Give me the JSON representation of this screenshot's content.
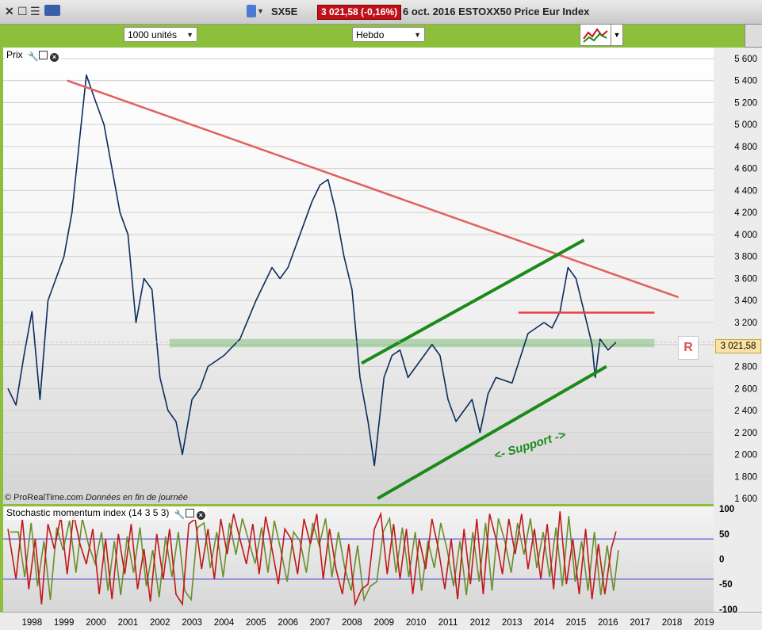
{
  "window": {
    "symbol": "SX5E",
    "price_badge": "3 021,58 (-0,16%)",
    "title": "6 oct. 2016 ESTOXX50 Price Eur Index"
  },
  "toolbar": {
    "units_select": "1000 unités",
    "period_select": "Hebdo"
  },
  "main_panel": {
    "label": "Prix",
    "credit_source": "© ProRealTime.com",
    "credit_note": "Données en fin de journée",
    "annotation_support": "<- Support ->",
    "resistance_tag": "R",
    "last_price_tag": "3 021,58"
  },
  "stoch_panel": {
    "label": "Stochastic momentum index (14 3 5 3)"
  },
  "colors": {
    "price_line": "#0b2d5b",
    "downtrend": "#e06060",
    "channel": "#1a8a1a",
    "support_zone": "#7ec27e",
    "resistance": "#e84040",
    "smi": "#c01818",
    "smi_signal": "#6a8e2a",
    "toolbar_bg": "#8cbf3a"
  },
  "chart_data": [
    {
      "type": "line",
      "x_ticks": [
        "1998",
        "1999",
        "2000",
        "2001",
        "2002",
        "2003",
        "2004",
        "2005",
        "2006",
        "2007",
        "2008",
        "2009",
        "2010",
        "2011",
        "2012",
        "2013",
        "2014",
        "2015",
        "2016",
        "2017",
        "2018",
        "2019"
      ],
      "y_ticks": [
        "1 600",
        "1 800",
        "2 000",
        "2 200",
        "2 400",
        "2 600",
        "2 800",
        "3 000",
        "3 200",
        "3 400",
        "3 600",
        "3 800",
        "4 000",
        "4 200",
        "4 400",
        "4 600",
        "4 800",
        "5 000",
        "5 200",
        "5 400",
        "5 600"
      ],
      "ylim": [
        1550,
        5700
      ],
      "xlim": [
        1997.6,
        2019.8
      ],
      "series": [
        {
          "x": [
            1997.75,
            1998.0,
            1998.25,
            1998.5,
            1998.75,
            1999.0,
            1999.25,
            1999.5,
            1999.75,
            2000.0,
            2000.2,
            2000.5,
            2000.75,
            2001.0,
            2001.25,
            2001.5,
            2001.75,
            2002.0,
            2002.25,
            2002.5,
            2002.75,
            2003.0,
            2003.2,
            2003.5,
            2003.75,
            2004.0,
            2004.5,
            2005.0,
            2005.5,
            2006.0,
            2006.25,
            2006.5,
            2007.0,
            2007.25,
            2007.5,
            2007.75,
            2008.0,
            2008.25,
            2008.5,
            2008.75,
            2009.0,
            2009.2,
            2009.5,
            2009.75,
            2010.0,
            2010.25,
            2010.5,
            2010.75,
            2011.0,
            2011.25,
            2011.5,
            2011.75,
            2012.0,
            2012.25,
            2012.5,
            2012.75,
            2013.0,
            2013.5,
            2014.0,
            2014.5,
            2014.75,
            2015.0,
            2015.25,
            2015.5,
            2015.75,
            2016.0,
            2016.1,
            2016.25,
            2016.5,
            2016.75
          ],
          "y": [
            2600,
            2450,
            2900,
            3300,
            2500,
            3400,
            3600,
            3800,
            4200,
            4900,
            5450,
            5200,
            5000,
            4600,
            4200,
            4000,
            3200,
            3600,
            3500,
            2700,
            2400,
            2300,
            2000,
            2500,
            2600,
            2800,
            2900,
            3050,
            3400,
            3700,
            3600,
            3700,
            4100,
            4300,
            4450,
            4500,
            4200,
            3800,
            3500,
            2700,
            2300,
            1900,
            2700,
            2900,
            2950,
            2700,
            2800,
            2900,
            3000,
            2900,
            2500,
            2300,
            2400,
            2500,
            2200,
            2550,
            2700,
            2650,
            3100,
            3200,
            3150,
            3300,
            3700,
            3600,
            3300,
            3000,
            2700,
            3050,
            2950,
            3020
          ]
        }
      ],
      "overlays": {
        "downtrend_line": {
          "x": [
            1999.6,
            2018.7
          ],
          "y": [
            5400,
            3430
          ]
        },
        "channel_upper": {
          "x": [
            2008.8,
            2015.75
          ],
          "y": [
            2830,
            3950
          ]
        },
        "channel_lower": {
          "x": [
            2009.3,
            2016.45
          ],
          "y": [
            1600,
            2800
          ]
        },
        "resistance_line": {
          "x": [
            2013.7,
            2017.95
          ],
          "y": [
            3290,
            3290
          ]
        },
        "support_zone": {
          "x": [
            2002.8,
            2017.95
          ],
          "y": [
            2975,
            3050
          ]
        },
        "last_price": 3021.58
      }
    },
    {
      "type": "line",
      "name": "Stochastic momentum index (14 3 5 3)",
      "y_ticks": [
        "100",
        "50",
        "0",
        "-50",
        "-100"
      ],
      "ylim": [
        -105,
        105
      ],
      "levels": [
        40,
        -40
      ],
      "series": [
        {
          "x": [
            1997.75,
            1998.0,
            1998.2,
            1998.4,
            1998.6,
            1998.8,
            1999.0,
            1999.2,
            1999.4,
            1999.6,
            1999.8,
            2000.0,
            2000.2,
            2000.4,
            2000.6,
            2000.8,
            2001.0,
            2001.2,
            2001.4,
            2001.6,
            2001.8,
            2002.0,
            2002.2,
            2002.4,
            2002.6,
            2002.8,
            2003.0,
            2003.2,
            2003.4,
            2003.6,
            2003.8,
            2004.0,
            2004.2,
            2004.4,
            2004.6,
            2004.8,
            2005.0,
            2005.2,
            2005.4,
            2005.6,
            2005.8,
            2006.0,
            2006.2,
            2006.4,
            2006.6,
            2006.8,
            2007.0,
            2007.2,
            2007.4,
            2007.6,
            2007.8,
            2008.0,
            2008.2,
            2008.4,
            2008.6,
            2008.8,
            2009.0,
            2009.2,
            2009.4,
            2009.6,
            2009.8,
            2010.0,
            2010.2,
            2010.4,
            2010.6,
            2010.8,
            2011.0,
            2011.2,
            2011.4,
            2011.6,
            2011.8,
            2012.0,
            2012.2,
            2012.4,
            2012.6,
            2012.8,
            2013.0,
            2013.2,
            2013.4,
            2013.6,
            2013.8,
            2014.0,
            2014.2,
            2014.4,
            2014.6,
            2014.8,
            2015.0,
            2015.2,
            2015.4,
            2015.6,
            2015.8,
            2016.0,
            2016.2,
            2016.4,
            2016.6,
            2016.75
          ],
          "y": [
            60,
            -40,
            80,
            -60,
            40,
            -90,
            70,
            20,
            85,
            -30,
            90,
            30,
            -10,
            60,
            -70,
            40,
            -80,
            50,
            -30,
            70,
            -60,
            20,
            -85,
            50,
            -40,
            60,
            -70,
            -90,
            70,
            80,
            -20,
            60,
            -40,
            80,
            10,
            90,
            40,
            -10,
            70,
            -30,
            85,
            20,
            -50,
            60,
            40,
            -30,
            80,
            30,
            90,
            -40,
            60,
            -20,
            -70,
            30,
            -90,
            -60,
            -50,
            60,
            90,
            -30,
            70,
            -40,
            60,
            -70,
            40,
            -20,
            80,
            20,
            -60,
            40,
            -80,
            60,
            -50,
            80,
            -70,
            90,
            40,
            -30,
            80,
            10,
            90,
            -20,
            60,
            -40,
            70,
            -60,
            95,
            -50,
            40,
            -70,
            60,
            -80,
            30,
            -70,
            20,
            55
          ]
        }
      ]
    }
  ]
}
